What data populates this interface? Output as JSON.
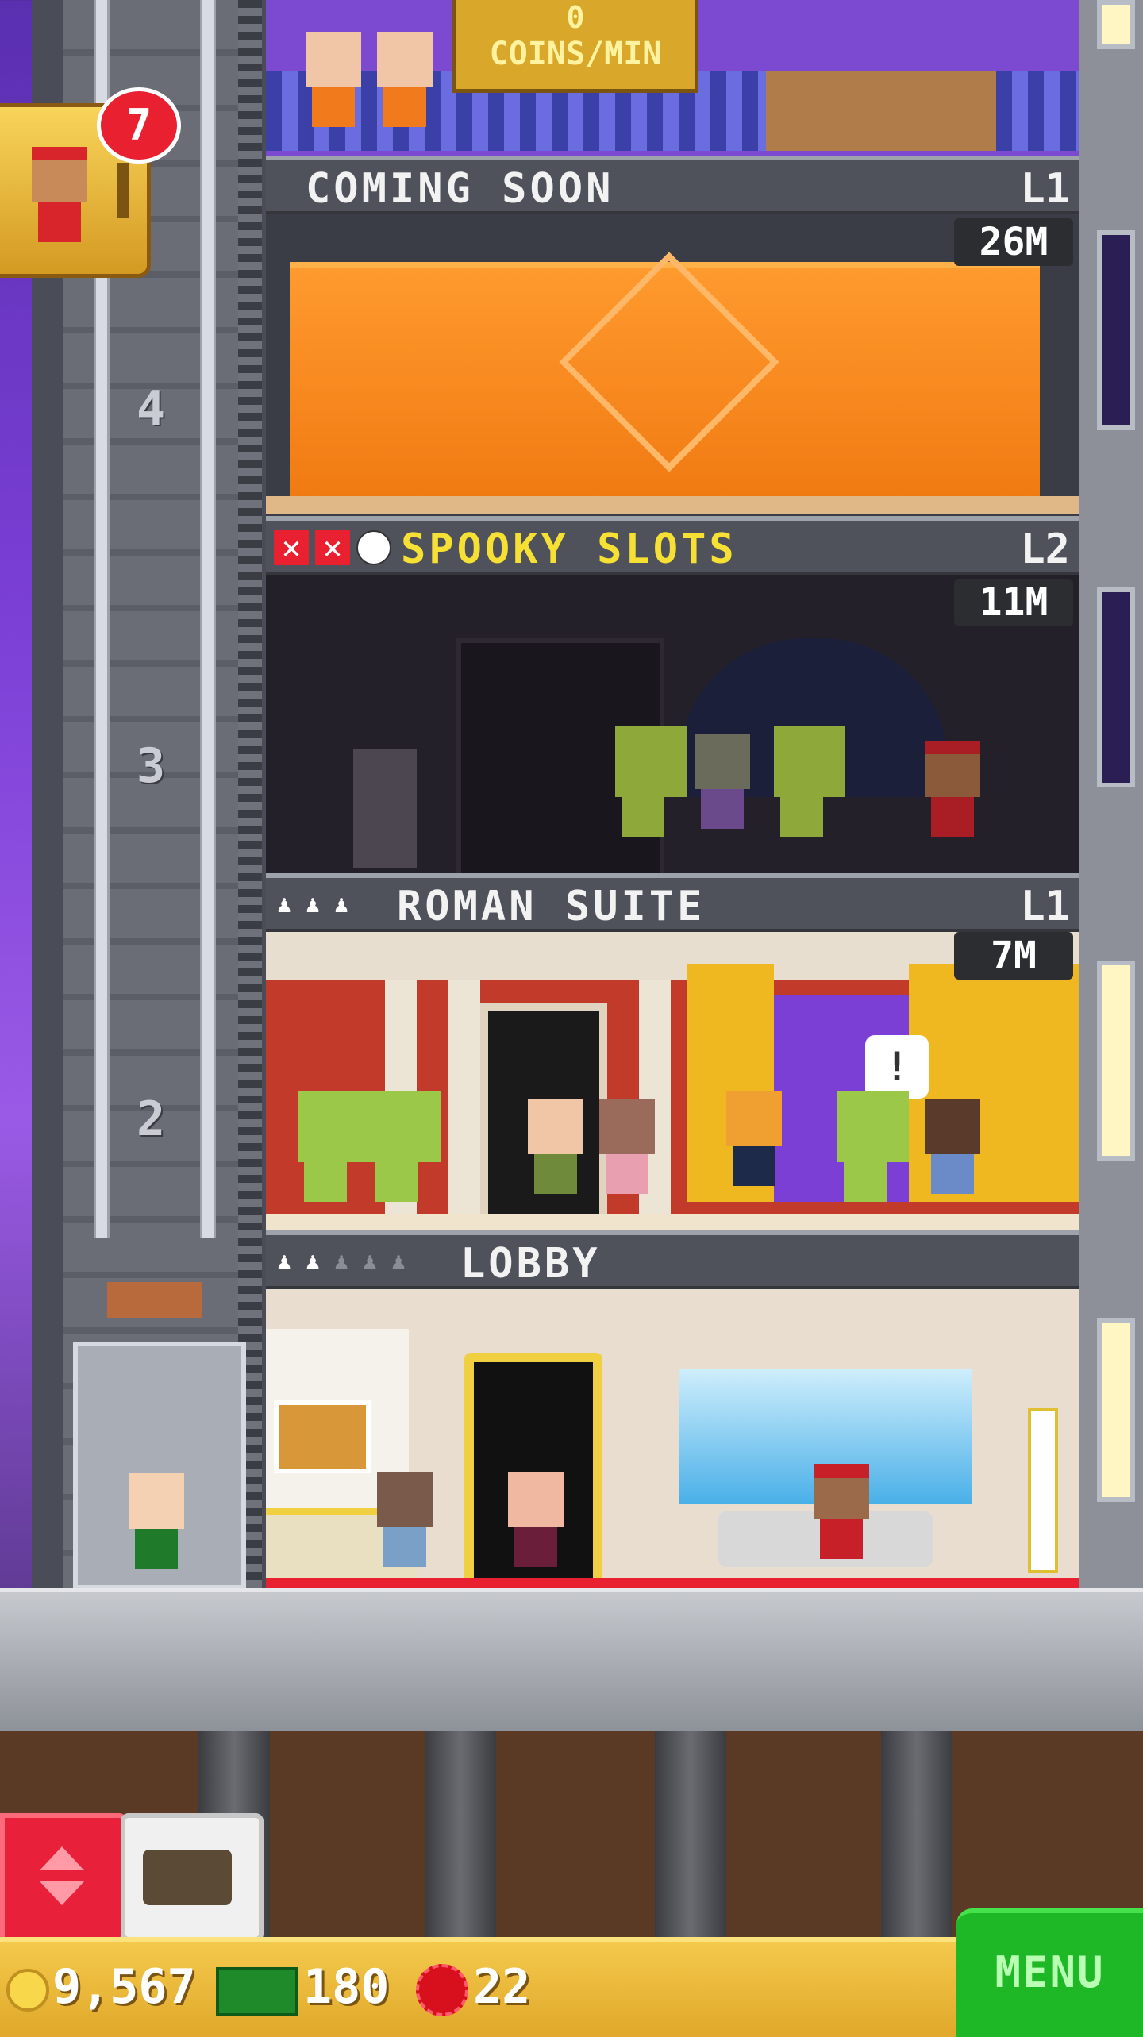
{
  "top_banner": {
    "coins_per_min_value": "0",
    "coins_per_min_label": "COINS/MIN"
  },
  "notification": {
    "badge_count": "7"
  },
  "elevator": {
    "floor_numbers": [
      "4",
      "3",
      "2"
    ]
  },
  "floors": [
    {
      "name": "COMING SOON",
      "level": "L1",
      "height": "26M",
      "status_icons": []
    },
    {
      "name": "SPOOKY SLOTS",
      "level": "L2",
      "height": "11M",
      "status_icons": [
        "x-icon",
        "x-icon",
        "clock-icon"
      ]
    },
    {
      "name": "ROMAN SUITE",
      "level": "L1",
      "height": "7M",
      "status_icons": [
        "resident-icon",
        "resident-icon",
        "resident-icon"
      ]
    },
    {
      "name": "LOBBY",
      "level": "",
      "height": "",
      "status_icons": [
        "resident-icon",
        "resident-icon",
        "resident-empty-icon",
        "resident-empty-icon",
        "resident-empty-icon"
      ]
    }
  ],
  "status_bar": {
    "coins": "9,567",
    "bux": "180",
    "vip_tokens": "22"
  },
  "menu": {
    "label": "MENU"
  },
  "colors": {
    "coin": "#f4c94c",
    "menu_green": "#1eb827",
    "title_yellow": "#f5e033",
    "alert_red": "#e8202f"
  }
}
